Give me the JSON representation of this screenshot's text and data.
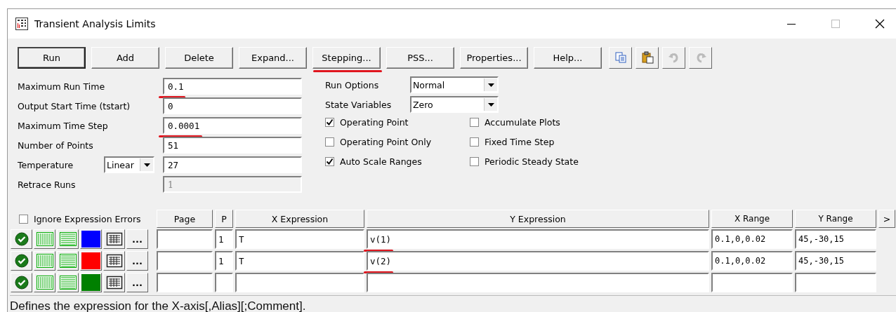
{
  "window": {
    "title": "Transient Analysis Limits"
  },
  "toolbar": {
    "buttons": [
      {
        "label": "Run",
        "default": true,
        "underlined": false
      },
      {
        "label": "Add",
        "default": false,
        "underlined": false
      },
      {
        "label": "Delete",
        "default": false,
        "underlined": false
      },
      {
        "label": "Expand...",
        "default": false,
        "underlined": false
      },
      {
        "label": "Stepping...",
        "default": false,
        "underlined": true
      },
      {
        "label": "PSS...",
        "default": false,
        "underlined": false
      },
      {
        "label": "Properties...",
        "default": false,
        "underlined": false
      },
      {
        "label": "Help...",
        "default": false,
        "underlined": false
      }
    ],
    "icon_buttons": [
      {
        "kind": "copy",
        "disabled": false
      },
      {
        "kind": "paste",
        "disabled": false
      },
      {
        "kind": "undo",
        "disabled": true
      },
      {
        "kind": "redo",
        "disabled": true
      }
    ]
  },
  "fields": [
    {
      "label": "Maximum Run Time",
      "value": "0.1",
      "underlined": true,
      "disabled": false
    },
    {
      "label": "Output Start Time (tstart)",
      "value": "0",
      "disabled": false
    },
    {
      "label": "Maximum Time Step",
      "value": "0.0001",
      "underlined": true,
      "disabled": false
    },
    {
      "label": "Number of Points",
      "value": "51",
      "disabled": false
    },
    {
      "label": "Temperature",
      "mode": "Linear",
      "value": "27",
      "disabled": false
    },
    {
      "label": "Retrace Runs",
      "value": "1",
      "disabled": true
    }
  ],
  "selects": [
    {
      "label": "Run Options",
      "value": "Normal"
    },
    {
      "label": "State Variables",
      "value": "Zero"
    }
  ],
  "checkboxes": [
    {
      "label": "Operating Point",
      "checked": true
    },
    {
      "label": "Operating Point Only",
      "checked": false
    },
    {
      "label": "Auto Scale Ranges",
      "checked": true
    },
    {
      "label": "Accumulate Plots",
      "checked": false
    },
    {
      "label": "Fixed Time Step",
      "checked": false
    },
    {
      "label": "Periodic Steady State",
      "checked": false
    }
  ],
  "expressions": {
    "ignore_errors": {
      "label": "Ignore Expression Errors",
      "checked": false
    },
    "columns": [
      "Page",
      "P",
      "X Expression",
      "Y Expression",
      "X Range",
      "Y Range",
      ">"
    ],
    "rows": [
      {
        "color": "#0000ff",
        "more": "...",
        "p": "1",
        "x_expression": "T",
        "y_expression": "v(1)",
        "y_underlined": true,
        "x_range": "0.1,0,0.02",
        "y_range": "45,-30,15"
      },
      {
        "color": "#ff0000",
        "more": "...",
        "p": "1",
        "x_expression": "T",
        "y_expression": "v(2)",
        "y_underlined": true,
        "x_range": "0.1,0,0.02",
        "y_range": "45,-30,15"
      },
      {
        "color": "#008000",
        "more": "..."
      }
    ]
  },
  "status_bar": "Defines the expression for the X-axis[,Alias][;Comment]."
}
